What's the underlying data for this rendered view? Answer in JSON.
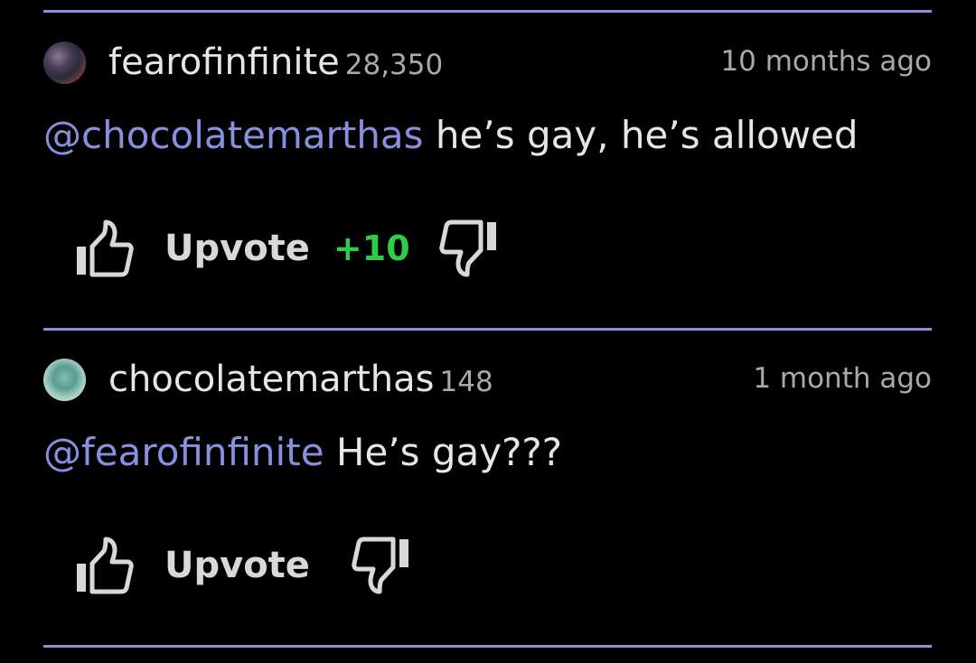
{
  "colors": {
    "background": "#000000",
    "divider": "#8a8fd6",
    "mention": "#8890de",
    "text": "#e6e6e6",
    "muted": "#a9a9a9",
    "score_positive": "#2fcc48"
  },
  "comments": [
    {
      "username": "fearofinfinite",
      "points": "28,350",
      "time": "10 months ago",
      "mention": "@chocolatemarthas",
      "text": " he’s gay, he’s allowed",
      "upvote_label": "Upvote",
      "score": "+10",
      "icons": {
        "upvote": "thumbs-up-icon",
        "downvote": "thumbs-down-icon"
      }
    },
    {
      "username": "chocolatemarthas",
      "points": "148",
      "time": "1 month ago",
      "mention": "@fearofinfinite",
      "text": " He’s gay???",
      "upvote_label": "Upvote",
      "score": "",
      "icons": {
        "upvote": "thumbs-up-icon",
        "downvote": "thumbs-down-icon"
      }
    }
  ]
}
